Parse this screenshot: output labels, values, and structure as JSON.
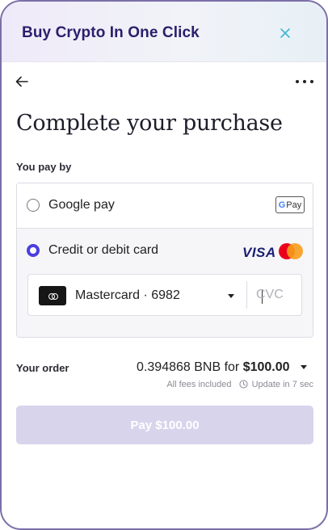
{
  "header": {
    "title": "Buy Crypto In One Click",
    "close_icon": "close-icon"
  },
  "nav": {
    "back_icon": "arrow-left-icon",
    "more_icon": "more-horizontal-icon"
  },
  "page": {
    "title": "Complete your purchase"
  },
  "payment": {
    "label": "You pay by",
    "options": [
      {
        "label": "Google pay",
        "selected": false,
        "badge_g": "G",
        "badge_text": "Pay"
      },
      {
        "label": "Credit or debit card",
        "selected": true,
        "brand_visa": "VISA"
      }
    ],
    "card": {
      "name": "Mastercard · 6982",
      "cvc_placeholder": "CVC",
      "cvc_value": ""
    }
  },
  "order": {
    "label": "Your order",
    "crypto_amount": "0.394868 BNB for",
    "fiat_amount": "$100.00",
    "fees_note": "All fees included",
    "update_note": "Update in 7 sec"
  },
  "pay_button": {
    "label": "Pay $100.00",
    "enabled": false
  },
  "colors": {
    "accent": "#4c3ee0",
    "title_color": "#2a1f6b",
    "button_disabled": "#d8d4ec",
    "frame_border": "#7b6fa8"
  }
}
